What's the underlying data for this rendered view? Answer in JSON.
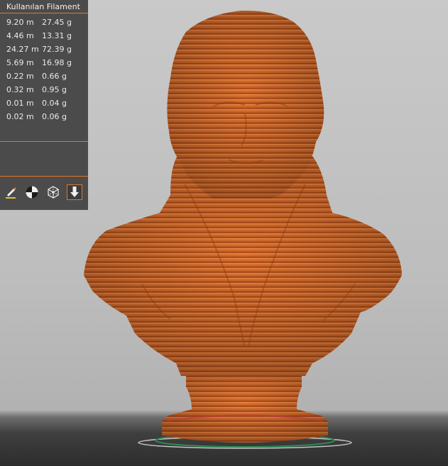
{
  "filament_panel": {
    "title": "Kullanılan Filament",
    "rows": [
      {
        "length": "9.20 m",
        "weight": "27.45 g"
      },
      {
        "length": "4.46 m",
        "weight": "13.31 g"
      },
      {
        "length": "24.27 m",
        "weight": "72.39 g"
      },
      {
        "length": "5.69 m",
        "weight": "16.98 g"
      },
      {
        "length": "0.22 m",
        "weight": "0.66 g"
      },
      {
        "length": "0.32 m",
        "weight": "0.95 g"
      },
      {
        "length": "0.01 m",
        "weight": "0.04 g"
      },
      {
        "length": "0.02 m",
        "weight": "0.06 g"
      }
    ]
  },
  "toolbar": {
    "icons": [
      "paint-brush-icon",
      "quarter-circle-icon",
      "wireframe-cube-icon",
      "download-arrow-icon"
    ],
    "selected": "download-arrow-icon"
  },
  "colors": {
    "panel_bg": "#4b4b4b",
    "accent": "#e0772b",
    "model": "#d9692a",
    "viewport_bg": "#c4c4c4",
    "bed": "#2d2d2d"
  }
}
